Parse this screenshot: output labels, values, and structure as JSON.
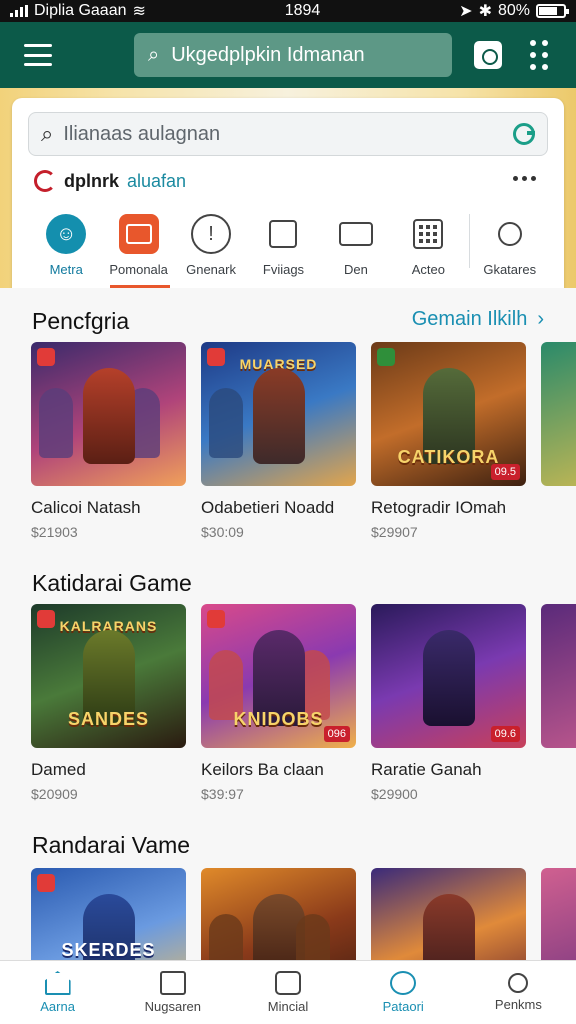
{
  "status_bar": {
    "carrier": "Diplia Gaaan",
    "time": "1894",
    "battery": "80%"
  },
  "appbar": {
    "search_text": "Ukgedplpkin Idmanan"
  },
  "card": {
    "search_placeholder": "Ilianaas aulagnan",
    "brand_name": "dplnrk",
    "brand_tag": "aluafan"
  },
  "categories": [
    {
      "label": "Metra",
      "icon": "user-icon"
    },
    {
      "label": "Pomonala",
      "icon": "image-icon"
    },
    {
      "label": "Gnenark",
      "icon": "clock-icon"
    },
    {
      "label": "Fviiags",
      "icon": "document-icon"
    },
    {
      "label": "Den",
      "icon": "card-icon"
    },
    {
      "label": "Acteo",
      "icon": "grid-icon"
    },
    {
      "label": "Gkatares",
      "icon": "pin-icon"
    }
  ],
  "sections": [
    {
      "title": "Pencfgria",
      "see_all": "Gemain Ilkilh",
      "items": [
        {
          "name": "Calicoi Natash",
          "price": "$21903",
          "rating": ""
        },
        {
          "name": "Odabetieri Noadd",
          "price": "$30:09",
          "rating": ""
        },
        {
          "name": "Retogradir IOmah",
          "price": "$29907",
          "rating": "09.5"
        }
      ]
    },
    {
      "title": "Katidarai Game",
      "see_all": "",
      "items": [
        {
          "name": "Damed",
          "price": "$20909",
          "rating": ""
        },
        {
          "name": "Keilors Ba claan",
          "price": "$39:97",
          "rating": "096"
        },
        {
          "name": "Raratie Ganah",
          "price": "$29900",
          "rating": "09.6"
        }
      ]
    },
    {
      "title": "Randarai Vame",
      "see_all": "",
      "items": [
        {
          "name": "",
          "price": "",
          "rating": ""
        },
        {
          "name": "",
          "price": "",
          "rating": ""
        },
        {
          "name": "",
          "price": "",
          "rating": ""
        }
      ]
    }
  ],
  "thumb_texts": {
    "s1_2": "MUARSED",
    "s1_3": "CATIKORA",
    "s2_1_top": "KALRARANS",
    "s2_1": "SANDES",
    "s2_2": "KNIDOBS",
    "s3_1": "SKERDES"
  },
  "bottom_nav": [
    {
      "label": "Aarna",
      "icon": "home-icon"
    },
    {
      "label": "Nugsaren",
      "icon": "document-icon"
    },
    {
      "label": "Mincial",
      "icon": "camera-icon"
    },
    {
      "label": "Pataori",
      "icon": "chat-icon"
    },
    {
      "label": "Penkms",
      "icon": "search-icon"
    }
  ],
  "colors": {
    "primary": "#0c5a49",
    "accent": "#1a8fb2",
    "danger": "#c9202c"
  }
}
